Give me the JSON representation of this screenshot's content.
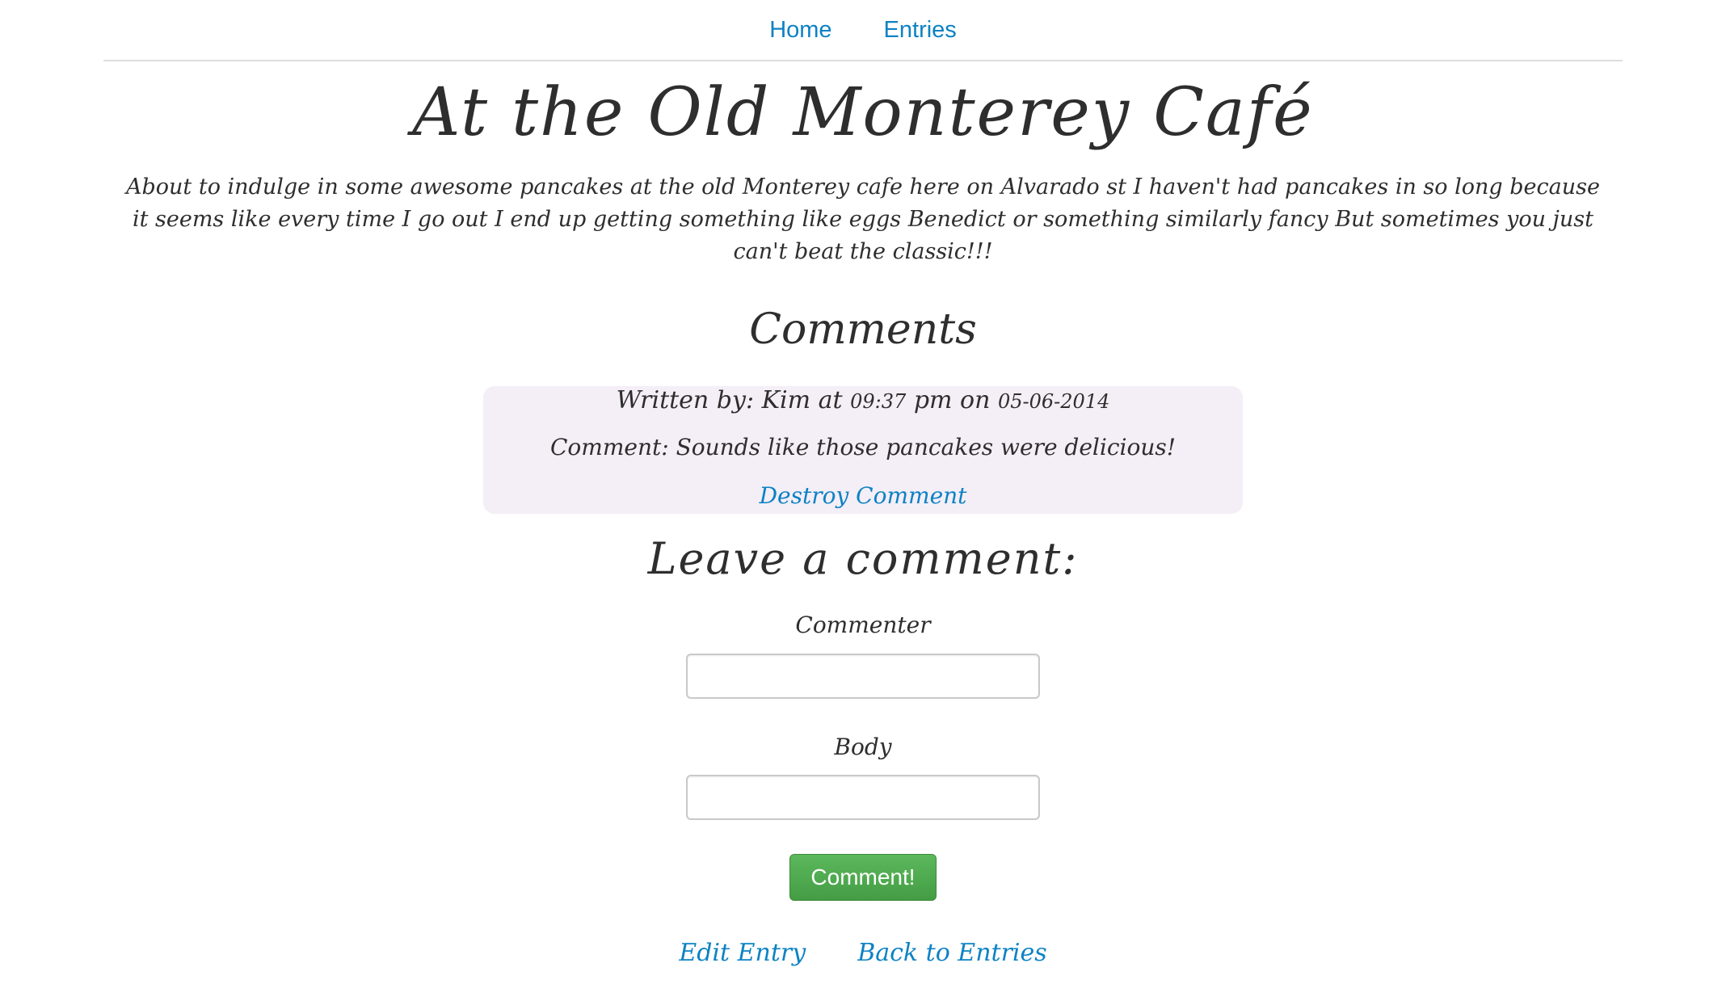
{
  "nav": {
    "home_label": "Home",
    "entries_label": "Entries"
  },
  "entry": {
    "title": "At the Old Monterey Café",
    "body": "About to indulge in some awesome pancakes at the old Monterey cafe here on Alvarado st I haven't had pancakes in so long because it seems like every time I go out I end up getting something like eggs Benedict or something similarly fancy But sometimes you just can't beat the classic!!!"
  },
  "comments": {
    "heading": "Comments",
    "items": [
      {
        "written_by_label": "Written by:",
        "author": "Kim",
        "at_label": "at",
        "time": "09:37",
        "meridiem": "pm",
        "on_label": "on",
        "date": "05-06-2014",
        "comment_label": "Comment:",
        "text": "Sounds like those pancakes were delicious!",
        "destroy_label": "Destroy Comment"
      }
    ]
  },
  "form": {
    "heading": "Leave a comment:",
    "commenter_label": "Commenter",
    "commenter_value": "",
    "body_label": "Body",
    "body_value": "",
    "submit_label": "Comment!"
  },
  "footer": {
    "edit_label": "Edit Entry",
    "back_label": "Back to Entries"
  },
  "colors": {
    "link": "#0d82c4",
    "comment_bg": "#f4eef6",
    "button_green": "#5cb85c"
  }
}
